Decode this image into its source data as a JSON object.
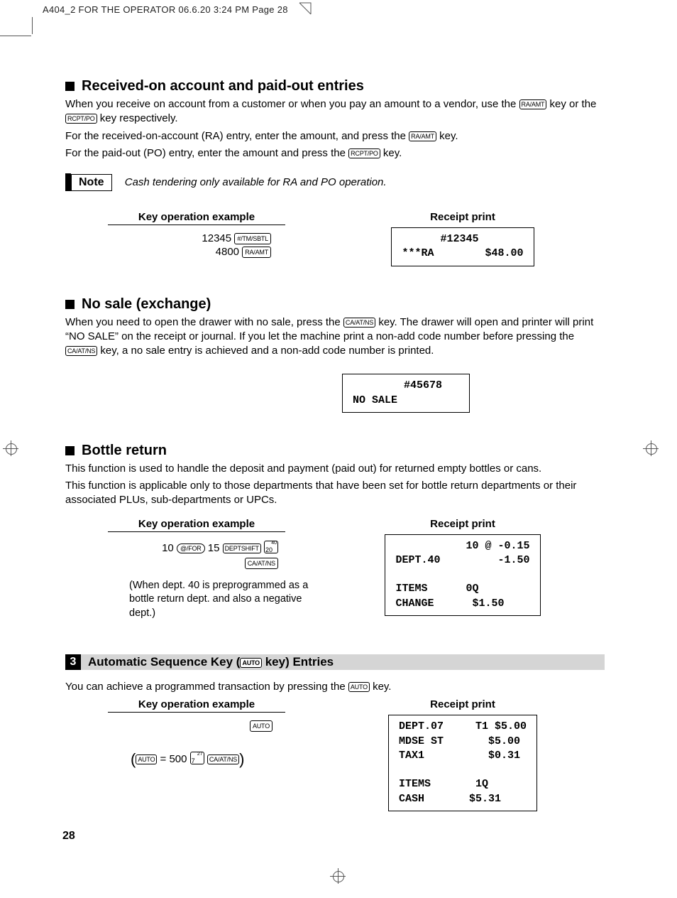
{
  "header": {
    "slug": "A404_2 FOR THE OPERATOR  06.6.20 3:24 PM  Page 28"
  },
  "section1": {
    "title": "Received-on account and paid-out entries",
    "p1a": "When you receive on account from a customer or when you pay an amount to a vendor, use the ",
    "p1b": " key or the ",
    "p1c": " key respectively.",
    "p2a": "For the received-on-account (RA) entry, enter the amount, and press the ",
    "p2b": " key.",
    "p3a": "For the paid-out (PO) entry, enter the amount and press the ",
    "p3b": " key.",
    "note_label": "Note",
    "note_text": "Cash tendering only available for RA and PO operation.",
    "key_op_head": "Key operation example",
    "receipt_head": "Receipt print",
    "key_op": {
      "l1_num": "12345",
      "l1_key": "#/TM/SBTL",
      "l2_num": "4800",
      "l2_key": "RA/AMT"
    },
    "receipt": "      #12345\n***RA        $48.00"
  },
  "keys": {
    "raamt": "RA/AMT",
    "rcptpo": "RCPT/PO",
    "caatns": "CA/AT/NS",
    "atfor": "@/FOR",
    "deptshift": "DEPTSHIFT",
    "auto": "AUTO"
  },
  "section2": {
    "title": "No sale (exchange)",
    "p1a": "When you need to open the drawer with no sale, press the ",
    "p1b": " key.  The drawer will open and printer will print “NO SALE” on the receipt or journal.  If you let the machine print a non-add code number before pressing the ",
    "p1c": " key, a no sale entry is achieved and a non-add code number is printed.",
    "receipt": "        #45678\nNO SALE"
  },
  "section3": {
    "title": "Bottle return",
    "p1": "This function is used to handle the deposit and payment (paid out) for returned empty bottles or cans.",
    "p2": "This function is applicable only to those departments that have been set for bottle return departments or their associated PLUs, sub-departments or UPCs.",
    "key_op_head": "Key operation example",
    "receipt_head": "Receipt print",
    "key_op": {
      "n1": "10",
      "n2": "15",
      "dept_top": "40",
      "dept_bot": "20"
    },
    "note": "(When dept. 40 is preprogrammed as a bottle return dept. and also a negative dept.)",
    "receipt": "           10 @ -0.15\nDEPT.40         -1.50\n\nITEMS      0Q\nCHANGE      $1.50"
  },
  "section4": {
    "num": "3",
    "title_a": "Automatic Sequence Key (",
    "title_b": " key) Entries",
    "p1a": "You can achieve a programmed transaction by pressing the ",
    "p1b": " key.",
    "key_op_head": "Key operation example",
    "receipt_head": "Receipt print",
    "eq_num": " = 500 ",
    "dept_top": "27",
    "dept_bot": "7",
    "receipt": "DEPT.07     T1 $5.00\nMDSE ST       $5.00\nTAX1          $0.31\n\nITEMS       1Q\nCASH       $5.31"
  },
  "page_number": "28"
}
